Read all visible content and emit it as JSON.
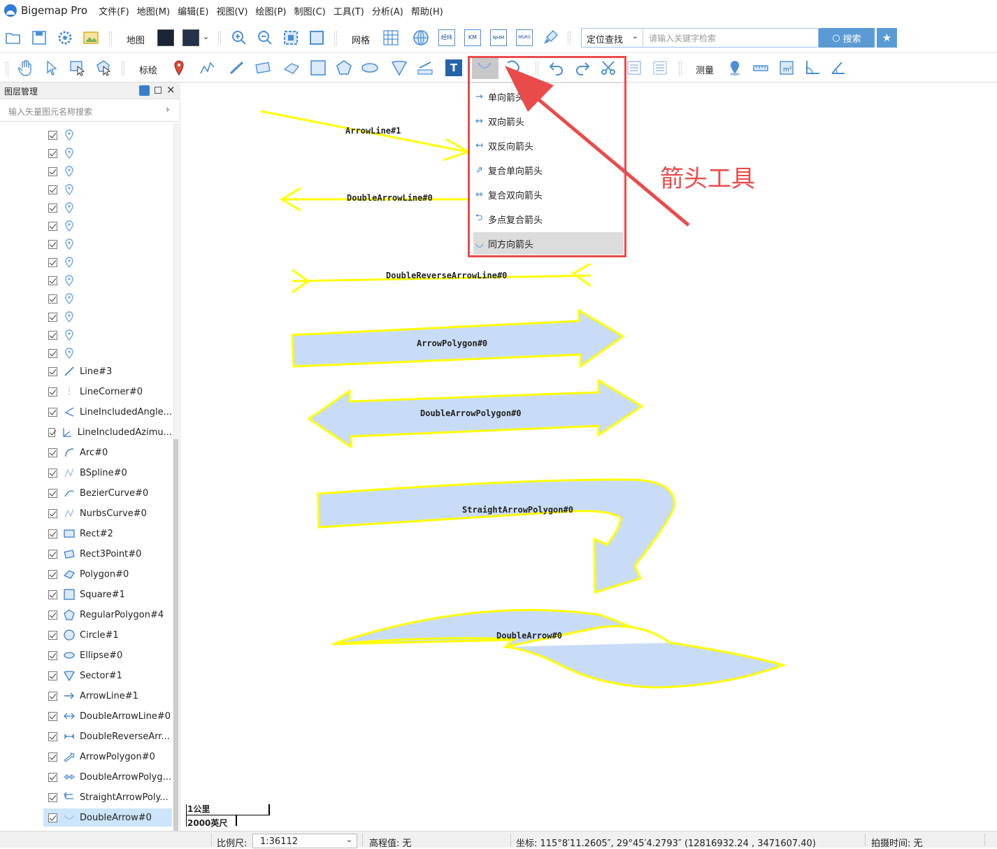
{
  "app": {
    "title": "Bigemap Pro"
  },
  "menubar": [
    "文件(F)",
    "地图(M)",
    "编辑(E)",
    "视图(V)",
    "绘图(P)",
    "制图(C)",
    "工具(T)",
    "分析(A)",
    "帮助(H)"
  ],
  "toolbar1": {
    "map_label": "地图",
    "grid_label": "网格",
    "locate_select": "定位查找",
    "search_placeholder": "请输入关键字检索",
    "search_button": "搜索",
    "grid_icon_labels": [
      "经纬",
      "KM",
      "NHM",
      "MGRS"
    ]
  },
  "toolbar2": {
    "draw_label": "标绘",
    "measure_label": "测量",
    "text_tool_glyph": "T"
  },
  "layer_panel": {
    "title": "图层管理",
    "search_placeholder": "输入矢量图元名称搜索",
    "marker_rows": 13,
    "items": [
      {
        "name": "Line#3",
        "icon": "line-icon"
      },
      {
        "name": "LineCorner#0",
        "icon": "line-corner-icon"
      },
      {
        "name": "LineIncludedAngle...",
        "icon": "included-angle-icon"
      },
      {
        "name": "LineIncludedAzimu...",
        "icon": "included-azimuth-icon"
      },
      {
        "name": "Arc#0",
        "icon": "arc-icon"
      },
      {
        "name": "BSpline#0",
        "icon": "bspline-icon"
      },
      {
        "name": "BezierCurve#0",
        "icon": "bezier-icon"
      },
      {
        "name": "NurbsCurve#0",
        "icon": "nurbs-icon"
      },
      {
        "name": "Rect#2",
        "icon": "rect-icon"
      },
      {
        "name": "Rect3Point#0",
        "icon": "rect3point-icon"
      },
      {
        "name": "Polygon#0",
        "icon": "polygon-icon"
      },
      {
        "name": "Square#1",
        "icon": "square-icon"
      },
      {
        "name": "RegularPolygon#4",
        "icon": "regular-polygon-icon"
      },
      {
        "name": "Circle#1",
        "icon": "circle-icon"
      },
      {
        "name": "Ellipse#0",
        "icon": "ellipse-icon"
      },
      {
        "name": "Sector#1",
        "icon": "sector-icon"
      },
      {
        "name": "ArrowLine#1",
        "icon": "arrow-line-icon"
      },
      {
        "name": "DoubleArrowLine#0",
        "icon": "double-arrow-line-icon"
      },
      {
        "name": "DoubleReverseArr...",
        "icon": "double-reverse-arrow-icon"
      },
      {
        "name": "ArrowPolygon#0",
        "icon": "arrow-polygon-icon"
      },
      {
        "name": "DoubleArrowPolyg...",
        "icon": "double-arrow-polygon-icon"
      },
      {
        "name": "StraightArrowPoly...",
        "icon": "straight-arrow-polygon-icon"
      },
      {
        "name": "DoubleArrow#0",
        "icon": "double-arrow-icon",
        "selected": true
      }
    ]
  },
  "arrow_menu": {
    "items": [
      {
        "label": "单向箭头",
        "icon": "single-arrow-icon"
      },
      {
        "label": "双向箭头",
        "icon": "double-arrow-icon"
      },
      {
        "label": "双反向箭头",
        "icon": "double-reverse-arrow-icon"
      },
      {
        "label": "复合单向箭头",
        "icon": "compound-single-arrow-icon"
      },
      {
        "label": "复合双向箭头",
        "icon": "compound-double-arrow-icon"
      },
      {
        "label": "多点复合箭头",
        "icon": "multipoint-arrow-icon"
      },
      {
        "label": "同方向箭头",
        "icon": "same-direction-arrow-icon",
        "highlighted": true
      }
    ]
  },
  "annotation": {
    "text": "箭头工具",
    "color": "#e94b4b"
  },
  "map_labels": {
    "arrow_line": "ArrowLine#1",
    "double_arrow_line": "DoubleArrowLine#0",
    "double_reverse": "DoubleReverseArrowLine#0",
    "arrow_polygon": "ArrowPolygon#0",
    "double_arrow_polygon": "DoubleArrowPolygon#0",
    "straight_arrow_polygon": "StraightArrowPolygon#0",
    "double_arrow": "DoubleArrow#0"
  },
  "scale_bar": {
    "km": "1公里",
    "ft": "2000英尺"
  },
  "statusbar": {
    "scale_label": "比例尺:",
    "scale_value": "1:36112",
    "elevation": "高程值: 无",
    "coords": "坐标: 115°8′11.2605″, 29°45′4.2793″  (12816932.24 , 3471607.40)",
    "capture_time": "拍摄时间: 无"
  },
  "colors": {
    "accent": "#5b9bd5",
    "shape_stroke": "#ffff00",
    "shape_fill": "#c9dcf7",
    "annotation": "#e94b4b"
  }
}
